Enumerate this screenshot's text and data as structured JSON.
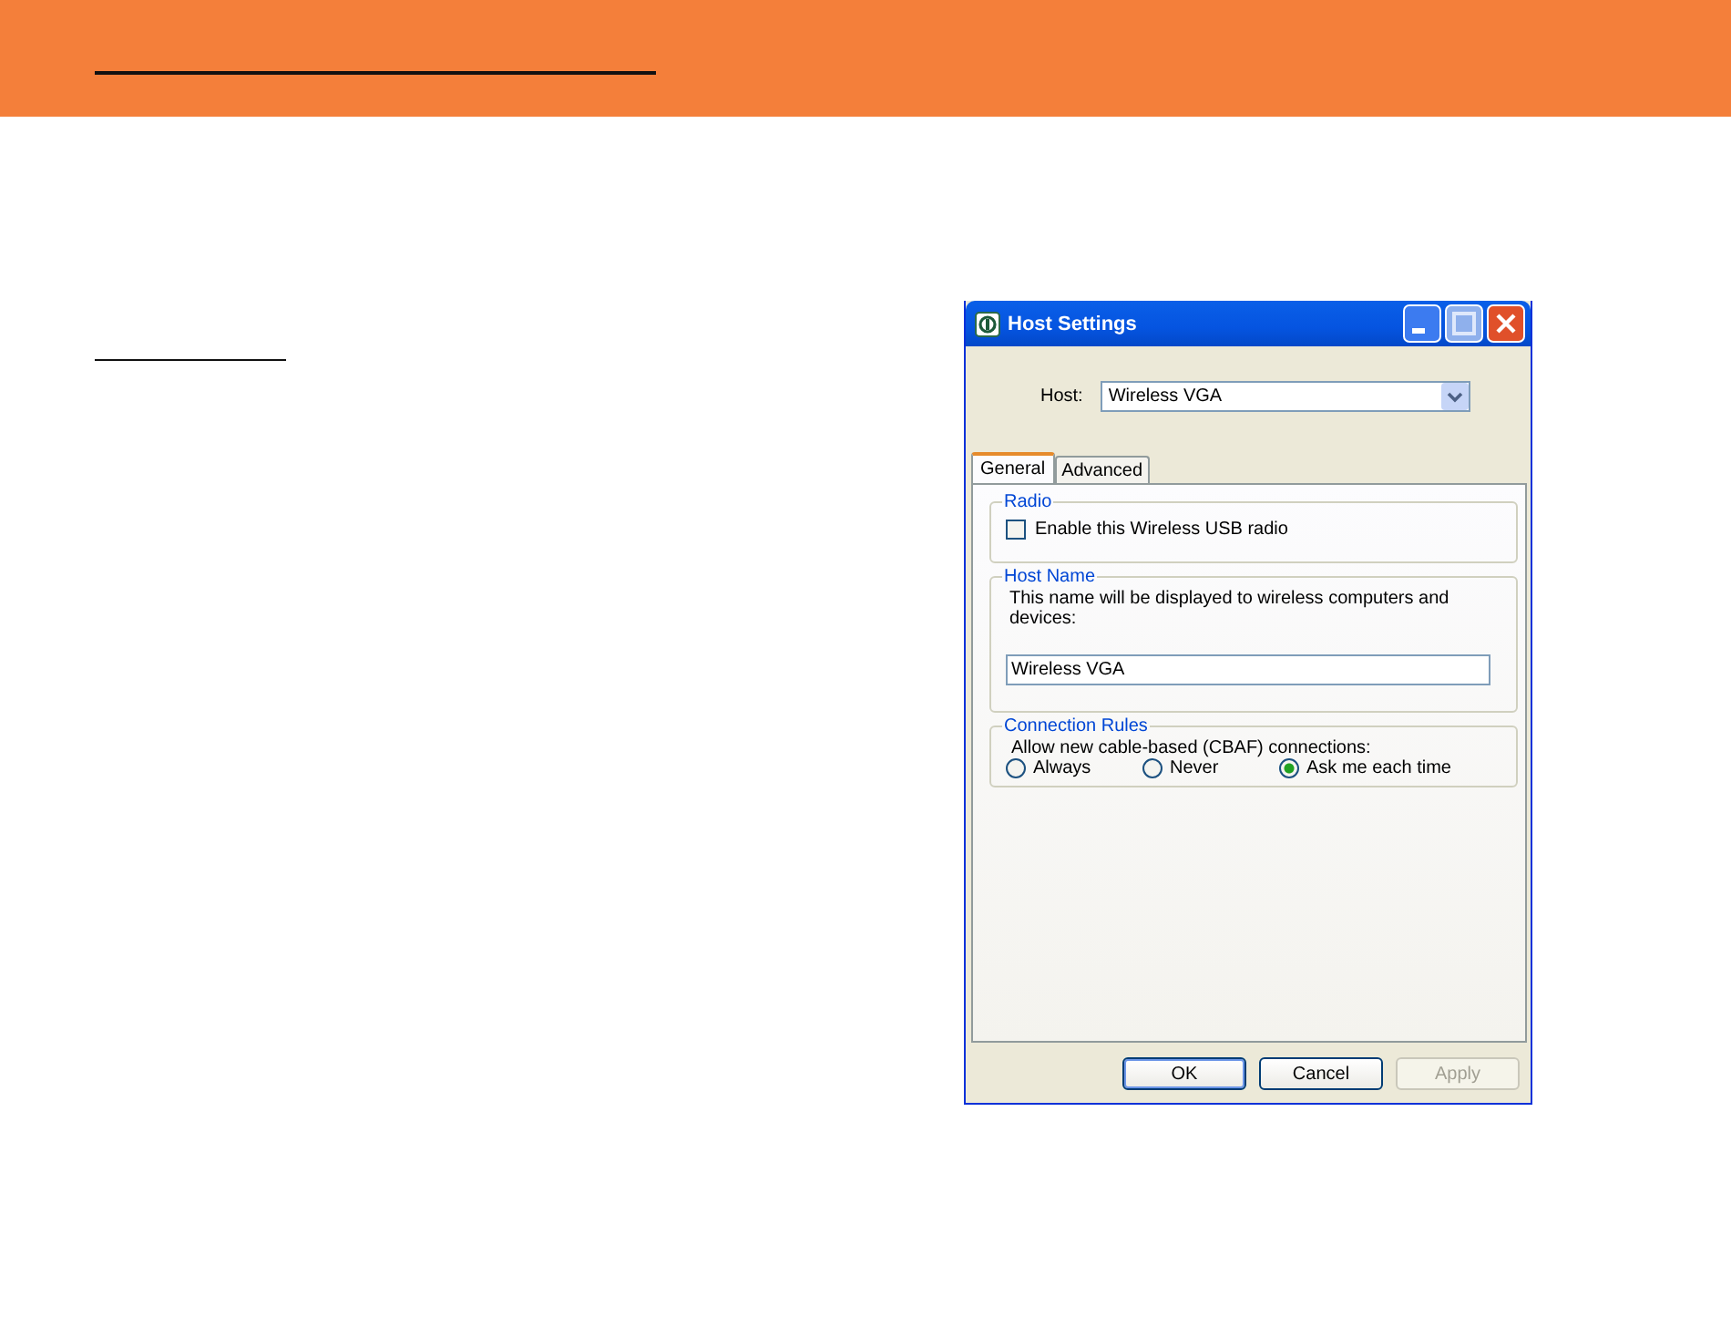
{
  "window": {
    "title": "Host Settings"
  },
  "host": {
    "label": "Host:",
    "value": "Wireless VGA"
  },
  "tabs": [
    {
      "label": "General",
      "selected": true
    },
    {
      "label": "Advanced",
      "selected": false
    }
  ],
  "groups": [
    {
      "kind": "checkbox",
      "title": "Radio",
      "label": "Enable this Wireless USB radio",
      "checked": false
    },
    {
      "kind": "text",
      "title": "Host Name",
      "description": "This name will be displayed to wireless computers and devices:",
      "value": "Wireless VGA"
    },
    {
      "kind": "radio",
      "title": "Connection Rules",
      "description": "Allow new cable-based (CBAF) connections:",
      "options": [
        {
          "label": "Always",
          "selected": false
        },
        {
          "label": "Never",
          "selected": false
        },
        {
          "label": "Ask me each time",
          "selected": true
        }
      ]
    }
  ],
  "buttons": [
    {
      "label": "OK",
      "default": true,
      "disabled": false
    },
    {
      "label": "Cancel",
      "default": false,
      "disabled": false
    },
    {
      "label": "Apply",
      "default": false,
      "disabled": true
    }
  ]
}
